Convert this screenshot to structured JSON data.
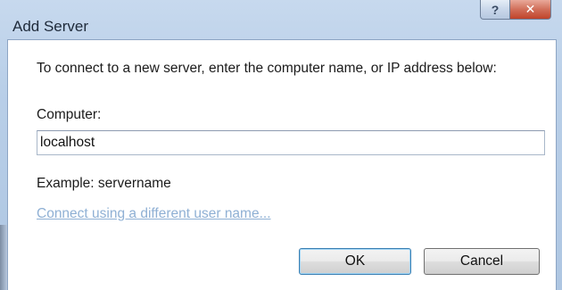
{
  "window": {
    "title": "Add Server",
    "help_glyph": "?",
    "close_glyph": "✕"
  },
  "form": {
    "instruction": "To connect to a new server, enter the computer name, or IP address below:",
    "computer_label": "Computer:",
    "computer_value": "localhost",
    "example_text": "Example: servername",
    "alt_credentials_link": "Connect using a different user name..."
  },
  "buttons": {
    "ok_label": "OK",
    "cancel_label": "Cancel"
  },
  "colors": {
    "frame": "#b9cfe8",
    "close_button": "#c0432a",
    "link_disabled": "#8fb0d4",
    "default_button_border": "#3c7fb1"
  }
}
